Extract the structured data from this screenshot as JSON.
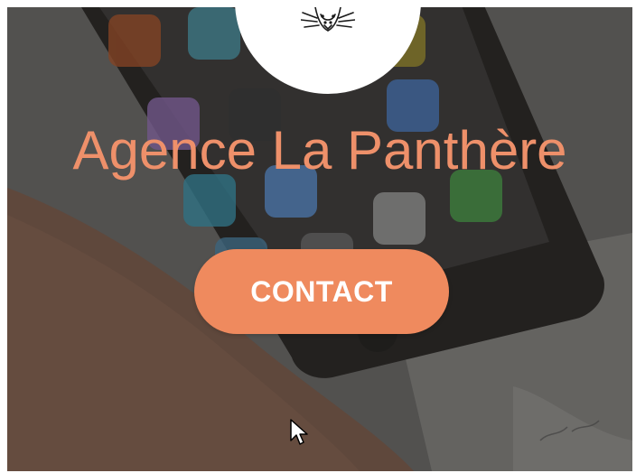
{
  "hero": {
    "headline": "Agence La Panthère",
    "cta_label": "CONTACT"
  },
  "logo": {
    "icon": "panther-head-icon"
  },
  "cursor": {
    "icon": "mouse-pointer-icon"
  },
  "colors": {
    "accent": "#ef8a5e",
    "headline": "#ee906a",
    "button_text": "#ffffff",
    "overlay": "#5b5a58"
  }
}
